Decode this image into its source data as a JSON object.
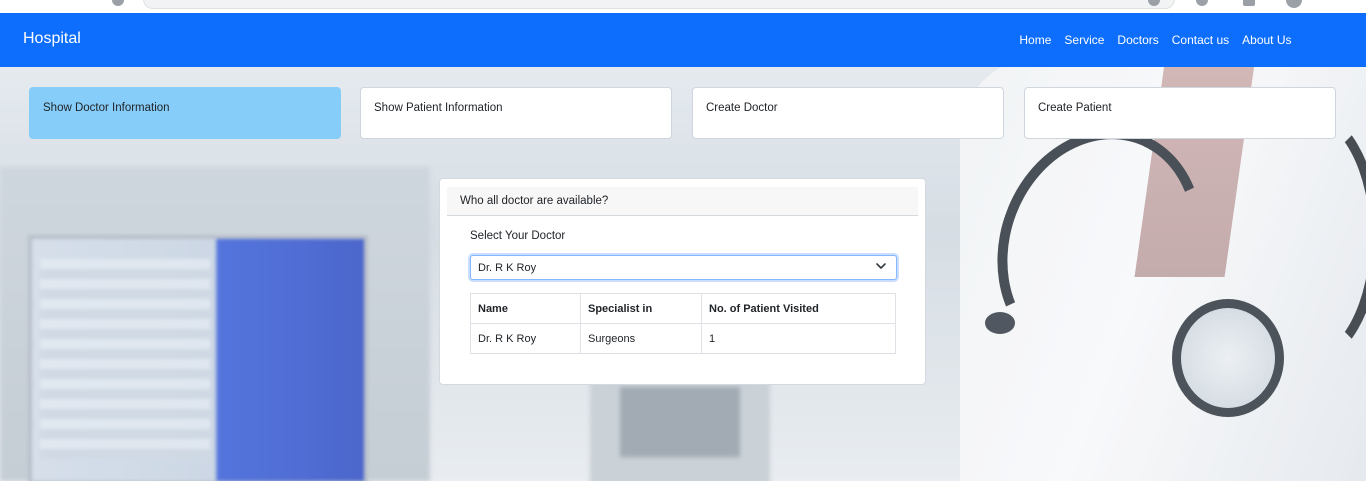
{
  "navbar": {
    "brand": "Hospital",
    "links": [
      "Home",
      "Service",
      "Doctors",
      "Contact us",
      "About Us"
    ]
  },
  "actions": [
    {
      "label": "Show Doctor Information",
      "active": true
    },
    {
      "label": "Show Patient Information",
      "active": false
    },
    {
      "label": "Create Doctor",
      "active": false
    },
    {
      "label": "Create Patient",
      "active": false
    }
  ],
  "panel": {
    "header": "Who all doctor are available?",
    "select_label": "Select Your Doctor",
    "selected_doctor": "Dr. R K Roy",
    "table": {
      "headers": [
        "Name",
        "Specialist in",
        "No. of Patient Visited"
      ],
      "rows": [
        [
          "Dr. R K Roy",
          "Surgeons",
          "1"
        ]
      ]
    }
  },
  "colors": {
    "navbar": "#0d6efd",
    "active_card": "#86cdf9"
  }
}
